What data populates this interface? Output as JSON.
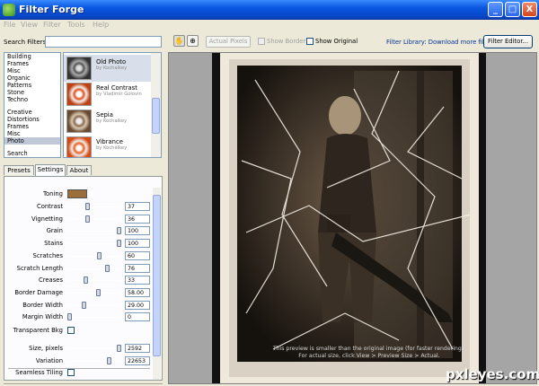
{
  "app": {
    "title": "Filter Forge"
  },
  "window_buttons": {
    "minimize": "_",
    "maximize": "□",
    "close": "X"
  },
  "menu": [
    "File",
    "View",
    "Filter",
    "Tools",
    "Help"
  ],
  "search": {
    "label": "Search Filters:",
    "value": ""
  },
  "categories": {
    "group1": [
      "Building",
      "Frames",
      "Misc",
      "Organic",
      "Patterns",
      "Stone",
      "Techno"
    ],
    "group2": [
      "Creative",
      "Distortions",
      "Frames",
      "Misc",
      "Photo"
    ],
    "selected": "Photo",
    "footer": "Search"
  },
  "filters": [
    {
      "name": "Old Photo",
      "author": "by Kochalkey"
    },
    {
      "name": "Real Contrast",
      "author": "by Vladimir Golovin"
    },
    {
      "name": "Sepia",
      "author": "by Kochalkey"
    },
    {
      "name": "Vibrance",
      "author": "by Kochalkey"
    }
  ],
  "tabs": [
    "Presets",
    "Settings",
    "About"
  ],
  "settings": {
    "toning": {
      "label": "Toning",
      "color": "#9b6e3a"
    },
    "sliders": [
      {
        "label": "Contrast",
        "value": "37",
        "level": 0.37
      },
      {
        "label": "Vignetting",
        "value": "36",
        "level": 0.36
      },
      {
        "label": "Grain",
        "value": "100",
        "level": 1.0
      },
      {
        "label": "Stains",
        "value": "100",
        "level": 1.0
      },
      {
        "label": "Scratches",
        "value": "60",
        "level": 0.6
      },
      {
        "label": "Scratch Length",
        "value": "76",
        "level": 0.76
      },
      {
        "label": "Creases",
        "value": "33",
        "level": 0.33
      },
      {
        "label": "Border Damage",
        "value": "58.00",
        "level": 0.58
      },
      {
        "label": "Border Width",
        "value": "29.00",
        "level": 0.29
      },
      {
        "label": "Margin Width",
        "value": "0",
        "level": 0.0
      }
    ],
    "transparent_bkg": {
      "label": "Transparent Bkg",
      "checked": false
    },
    "sliders2": [
      {
        "label": "Size, pixels",
        "value": "2592",
        "level": 1.0
      },
      {
        "label": "Variation",
        "value": "22653",
        "level": 0.8
      }
    ],
    "seamless": {
      "label": "Seamless Tiling",
      "checked": false
    }
  },
  "toolbar": {
    "hand_icon": "hand-icon",
    "zoom_icon": "zoom-icon",
    "actual_pixels": "Actual Pixels",
    "show_border": "Show Border",
    "show_original": "Show Original",
    "library_link": "Filter Library: Download more filters",
    "filter_editor": "Filter Editor..."
  },
  "preview": {
    "note_line1": "This preview is smaller than the original image (for faster rendering).",
    "note_line2": "For actual size, click View > Preview Size > Actual."
  },
  "watermark": "pxleyes.com"
}
